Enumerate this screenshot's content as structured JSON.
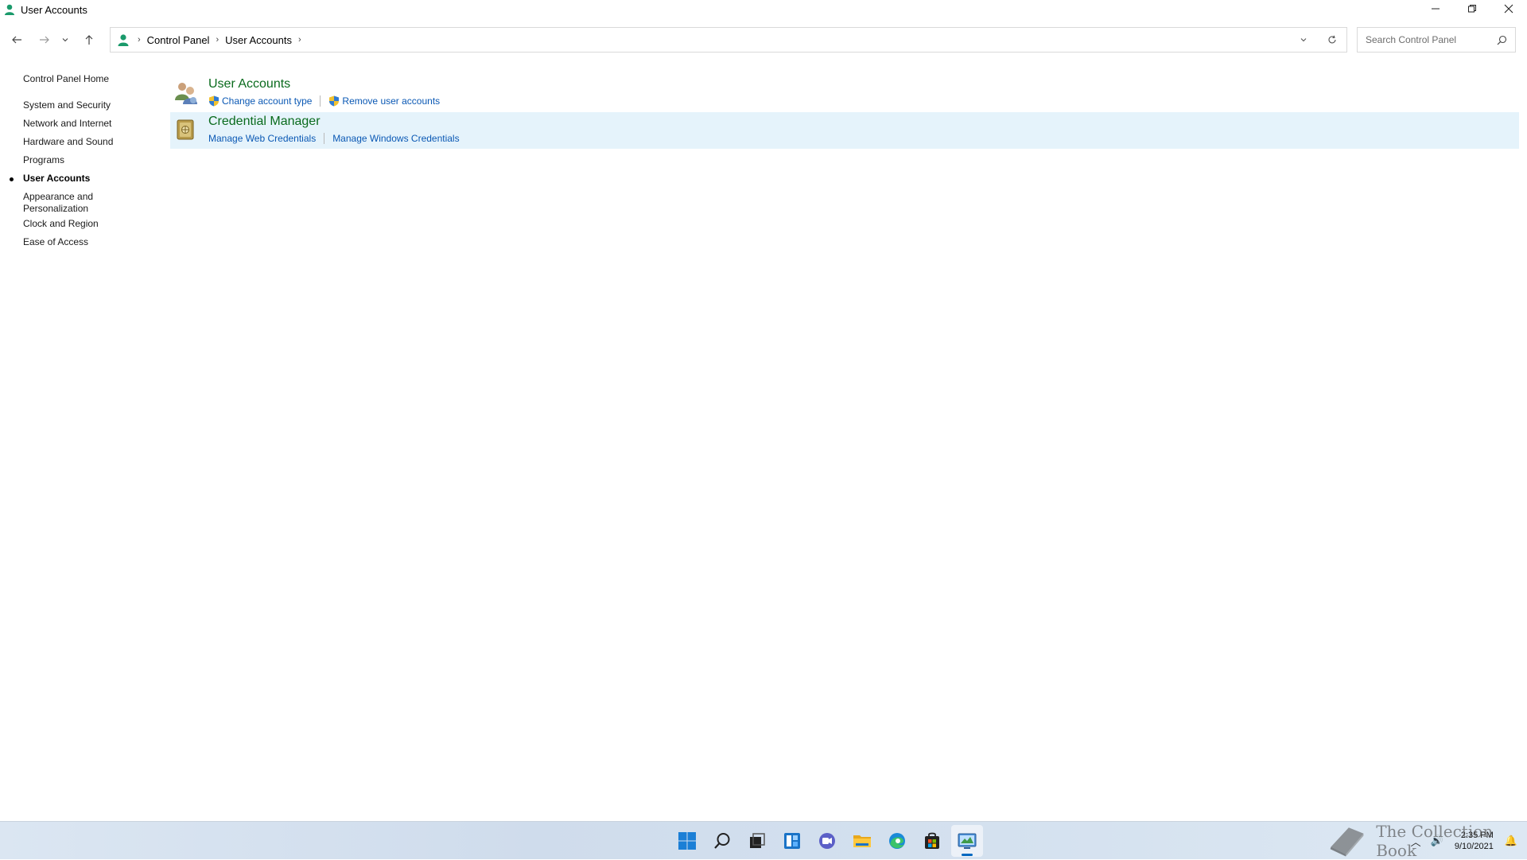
{
  "window": {
    "title": "User Accounts",
    "controls": {
      "minimize": "—",
      "restore": "❐",
      "close": "✕"
    }
  },
  "nav": {
    "back": "←",
    "forward": "→",
    "recent": "⌄",
    "up": "↑"
  },
  "address": {
    "crumbs": [
      "Control Panel",
      "User Accounts"
    ],
    "separator": "›",
    "dropdown": "⌄",
    "refresh": "↻"
  },
  "search": {
    "placeholder": "Search Control Panel",
    "value": ""
  },
  "sidebar": {
    "home": "Control Panel Home",
    "items": [
      {
        "label": "System and Security",
        "active": false
      },
      {
        "label": "Network and Internet",
        "active": false
      },
      {
        "label": "Hardware and Sound",
        "active": false
      },
      {
        "label": "Programs",
        "active": false
      },
      {
        "label": "User Accounts",
        "active": true
      },
      {
        "label": "Appearance and Personalization",
        "active": false
      },
      {
        "label": "Clock and Region",
        "active": false
      },
      {
        "label": "Ease of Access",
        "active": false
      }
    ]
  },
  "groups": [
    {
      "title": "User Accounts",
      "icon": "users-icon",
      "highlighted": false,
      "links": [
        {
          "label": "Change account type",
          "shield": true
        },
        {
          "label": "Remove user accounts",
          "shield": true
        }
      ]
    },
    {
      "title": "Credential Manager",
      "icon": "vault-icon",
      "highlighted": true,
      "links": [
        {
          "label": "Manage Web Credentials",
          "shield": false
        },
        {
          "label": "Manage Windows Credentials",
          "shield": false
        }
      ]
    }
  ],
  "taskbar": {
    "apps": [
      "start-icon",
      "search-icon",
      "task-view-icon",
      "widgets-icon",
      "chat-icon",
      "file-explorer-icon",
      "edge-icon",
      "store-icon",
      "control-panel-icon"
    ],
    "active_app": "control-panel-icon",
    "tray": {
      "chevron": "︿",
      "volume": "🔊",
      "notification": "🔔"
    },
    "time": "2:35 PM",
    "date": "9/10/2021"
  },
  "watermark": {
    "text": "The Collection Book"
  },
  "colors": {
    "group_title": "#0a6b1d",
    "link": "#0a58b4",
    "highlight": "#e5f3fb",
    "accent": "#0067c0"
  }
}
